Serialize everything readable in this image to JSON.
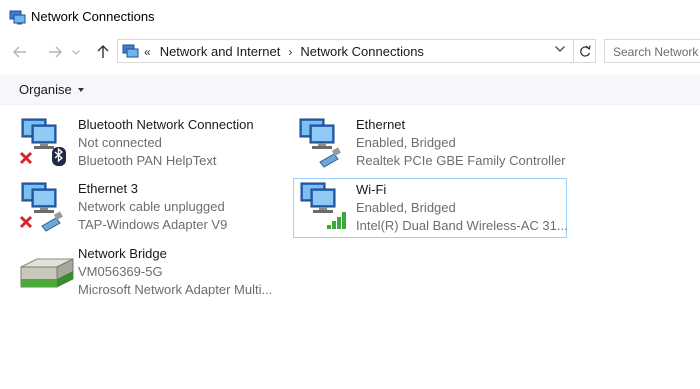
{
  "window": {
    "title": "Network Connections",
    "icon": "network-connections-icon"
  },
  "nav": {
    "back": "back-arrow-icon",
    "forward": "forward-arrow-icon",
    "recent": "chevron-down-icon",
    "up": "up-arrow-icon"
  },
  "address": {
    "lead": "«",
    "crumbs": [
      "Network and Internet",
      "Network Connections"
    ],
    "separator": "›"
  },
  "search": {
    "placeholder": "Search Network Connections",
    "visible_text": "Search Network"
  },
  "toolbar": {
    "organise": "Organise"
  },
  "connections": [
    {
      "name": "Bluetooth Network Connection",
      "status": "Not connected",
      "device": "Bluetooth PAN HelpText",
      "icon": "bluetooth-network-icon",
      "disabled": true,
      "selected": false
    },
    {
      "name": "Ethernet",
      "status": "Enabled, Bridged",
      "device": "Realtek PCIe GBE Family Controller",
      "icon": "ethernet-network-icon",
      "disabled": false,
      "selected": false
    },
    {
      "name": "Ethernet 3",
      "status": "Network cable unplugged",
      "device": "TAP-Windows Adapter V9",
      "icon": "ethernet-network-icon",
      "disabled": true,
      "selected": false
    },
    {
      "name": "Wi-Fi",
      "status": "Enabled, Bridged",
      "device": "Intel(R) Dual Band Wireless-AC 31...",
      "icon": "wifi-network-icon",
      "disabled": false,
      "selected": true
    },
    {
      "name": "Network Bridge",
      "status": "VM056369-5G",
      "device": "Microsoft Network Adapter Multi...",
      "icon": "network-bridge-icon",
      "disabled": false,
      "selected": false
    }
  ],
  "colors": {
    "selection_border": "#99d1ff",
    "toolbar_bg": "#f5f7fa",
    "error_red": "#d9262c",
    "signal_green": "#3aa93a"
  }
}
